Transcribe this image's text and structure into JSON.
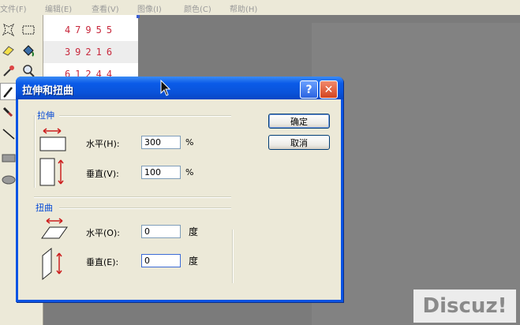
{
  "menu": {
    "items": [
      "文件(F)",
      "编辑(E)",
      "查看(V)",
      "图像(I)",
      "颜色(C)",
      "帮助(H)"
    ]
  },
  "toolbox": {
    "tools": [
      "free-select-icon",
      "rect-select-icon",
      "eraser-icon",
      "fill-icon",
      "eyedropper-icon",
      "magnifier-icon",
      "pencil-icon",
      "brush-icon",
      "line-icon",
      "rectangle-icon",
      "ellipse-icon"
    ]
  },
  "canvas": {
    "rows": [
      "47955",
      "39216",
      "61244"
    ]
  },
  "dialog": {
    "title": "拉伸和扭曲",
    "help_symbol": "?",
    "close_symbol": "✕",
    "stretch": {
      "group_label": "拉伸",
      "horizontal_label": "水平(H):",
      "horizontal_value": "300",
      "horizontal_unit": "%",
      "vertical_label": "垂直(V):",
      "vertical_value": "100",
      "vertical_unit": "%"
    },
    "skew": {
      "group_label": "扭曲",
      "horizontal_label": "水平(O):",
      "horizontal_value": "0",
      "horizontal_unit": "度",
      "vertical_label": "垂直(E):",
      "vertical_value": "0",
      "vertical_unit": "度"
    },
    "ok_label": "确定",
    "cancel_label": "取消"
  },
  "watermark": "Discuz!"
}
